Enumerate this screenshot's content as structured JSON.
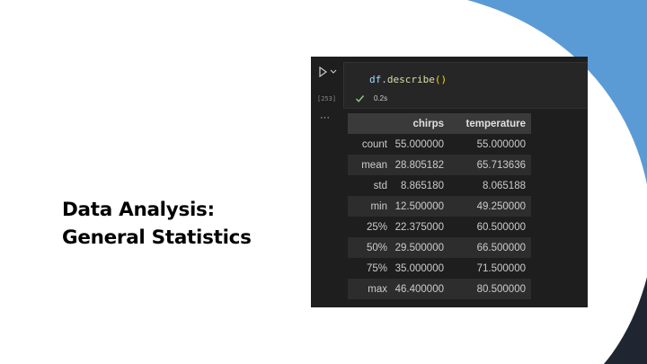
{
  "slide": {
    "title_line1": "Data Analysis:",
    "title_line2": "General Statistics"
  },
  "colors": {
    "accent_blue": "#5b9bd5",
    "dark_navy": "#1f2631",
    "notebook_bg": "#1e1e1e",
    "success_green": "#89d185"
  },
  "notebook": {
    "code": {
      "var": "df",
      "dot": ".",
      "method": "describe",
      "parens": "()"
    },
    "execution_count": "[253]",
    "status_icon": "check-icon",
    "exec_time": "0.2s",
    "more_label": "···",
    "run_icon": "play-icon",
    "chevron_icon": "chevron-down-icon"
  },
  "table": {
    "columns": [
      "",
      "chirps",
      "temperature"
    ],
    "rows": [
      {
        "index": "count",
        "chirps": "55.000000",
        "temperature": "55.000000"
      },
      {
        "index": "mean",
        "chirps": "28.805182",
        "temperature": "65.713636"
      },
      {
        "index": "std",
        "chirps": "8.865180",
        "temperature": "8.065188"
      },
      {
        "index": "min",
        "chirps": "12.500000",
        "temperature": "49.250000"
      },
      {
        "index": "25%",
        "chirps": "22.375000",
        "temperature": "60.500000"
      },
      {
        "index": "50%",
        "chirps": "29.500000",
        "temperature": "66.500000"
      },
      {
        "index": "75%",
        "chirps": "35.000000",
        "temperature": "71.500000"
      },
      {
        "index": "max",
        "chirps": "46.400000",
        "temperature": "80.500000"
      }
    ]
  }
}
